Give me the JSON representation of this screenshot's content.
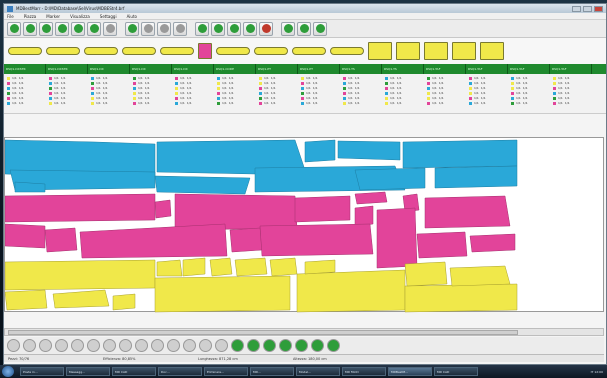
{
  "window": {
    "title": "MDBestMarr - D:\\MD\\Database\\Sel\\Virus\\MDBEStr4.brf"
  },
  "menu": [
    "File",
    "Piazza",
    "Marker",
    "Visualizza",
    "Settaggi",
    "Aiuto"
  ],
  "toolbar": {
    "buttons": [
      {
        "icon": "play-icon",
        "color": "#2e9d3a"
      },
      {
        "icon": "forward-icon",
        "color": "#2e9d3a"
      },
      {
        "icon": "record-icon",
        "color": "#2e9d3a"
      },
      {
        "icon": "save-icon",
        "color": "#2e9d3a"
      },
      {
        "icon": "export-icon",
        "color": "#2e9d3a"
      },
      {
        "icon": "undo-icon",
        "color": "#2e9d3a"
      },
      {
        "icon": "stop-icon",
        "color": "#9a9a9a"
      },
      {
        "icon": "cursor-icon",
        "color": "#2e9d3a"
      },
      {
        "icon": "select-icon",
        "color": "#9a9a9a"
      },
      {
        "icon": "copy-icon",
        "color": "#9a9a9a"
      },
      {
        "icon": "paste-icon",
        "color": "#9a9a9a"
      },
      {
        "icon": "rotate-icon",
        "color": "#2e9d3a"
      },
      {
        "icon": "flip-icon",
        "color": "#2e9d3a"
      },
      {
        "icon": "wave-icon",
        "color": "#2e9d3a"
      },
      {
        "icon": "layer-icon",
        "color": "#2e9d3a"
      },
      {
        "icon": "color-icon",
        "color": "#c0392b"
      },
      {
        "icon": "user-icon",
        "color": "#2e9d3a"
      },
      {
        "icon": "add-icon",
        "color": "#2e9d3a"
      },
      {
        "icon": "ok-icon",
        "color": "#2e9d3a"
      }
    ]
  },
  "pieces": [
    {
      "shape": "bar",
      "color": "#f0e84a",
      "w": 26
    },
    {
      "shape": "bar",
      "color": "#f0e84a",
      "w": 26
    },
    {
      "shape": "bar",
      "color": "#f0e84a",
      "w": 26
    },
    {
      "shape": "bar",
      "color": "#f0e84a",
      "w": 26
    },
    {
      "shape": "bar",
      "color": "#f0e84a",
      "w": 26
    },
    {
      "shape": "block",
      "color": "#e2449a",
      "w": 14
    },
    {
      "shape": "bar",
      "color": "#f0e84a",
      "w": 26
    },
    {
      "shape": "bar",
      "color": "#f0e84a",
      "w": 26
    },
    {
      "shape": "bar",
      "color": "#f0e84a",
      "w": 26
    },
    {
      "shape": "bar",
      "color": "#f0e84a",
      "w": 26
    },
    {
      "shape": "square",
      "color": "#f0e84a",
      "w": 22
    },
    {
      "shape": "square",
      "color": "#f0e84a",
      "w": 22
    },
    {
      "shape": "square",
      "color": "#f0e84a",
      "w": 22
    },
    {
      "shape": "square",
      "color": "#f0e84a",
      "w": 22
    },
    {
      "shape": "square",
      "color": "#f0e84a",
      "w": 22
    }
  ],
  "piece_labels": [
    "RSQ1-DXSTR",
    "RSQ1-DXSTR",
    "RSQ1-DX",
    "RSQ1-DX",
    "RSQ1-DX",
    "RSQ1-CODE",
    "RSQ1-PT",
    "RSQ1-PT",
    "RSQ1-TS",
    "RSQ1-TS",
    "RSQ1-TAF",
    "RSQ1-TAF",
    "RSQ1-TAF",
    "RSQ1-TAF"
  ],
  "grid_rows": [
    {
      "colors": [
        "#f0e84a",
        "#e2449a",
        "#2aa8d8",
        "#2e9d3a",
        "#e2449a",
        "#2aa8d8",
        "#f0e84a"
      ],
      "a": "1/1",
      "b": "1/1"
    }
  ],
  "status": {
    "pezzi": "Pezzi: 70/76",
    "efficienza": "Efficienza: 80,85%",
    "lunghezza": "Lunghezza: 871,28 cm",
    "altezza": "Altezza: 180,00 cm"
  },
  "taskbar": [
    {
      "label": "Posta in...",
      "active": false
    },
    {
      "label": "Messagg...",
      "active": false
    },
    {
      "label": "MD CAD",
      "active": false
    },
    {
      "label": "Doc...",
      "active": false
    },
    {
      "label": "Eliminare...",
      "active": false
    },
    {
      "label": "MD...",
      "active": false
    },
    {
      "label": "Model...",
      "active": false
    },
    {
      "label": "MD FACD",
      "active": false
    },
    {
      "label": "MDBestM...",
      "active": true
    },
    {
      "label": "MD CAD",
      "active": false
    }
  ],
  "tray": "IT  12:00",
  "colors": {
    "cyan": "#2aa8d8",
    "magenta": "#e2449a",
    "yellow": "#f0e84a",
    "green": "#1f8a2e"
  }
}
